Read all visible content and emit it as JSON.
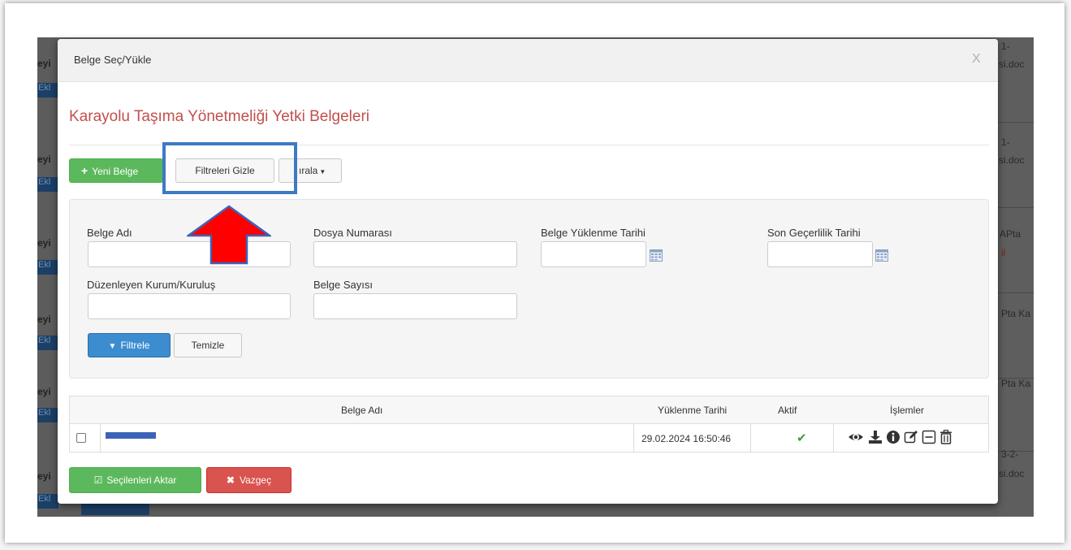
{
  "modal": {
    "title": "Belge Seç/Yükle",
    "close_label": "X",
    "heading": "Karayolu Taşıma Yönetmeliği Yetki Belgeleri"
  },
  "toolbar": {
    "new_document": "Yeni Belge",
    "hide_filters": "Filtreleri Gizle",
    "sort_partial": "ırala"
  },
  "filters": {
    "belge_adi_label": "Belge Adı",
    "dosya_numarasi_label": "Dosya Numarası",
    "yuklenme_tarihi_label": "Belge Yüklenme Tarihi",
    "son_gecerlilik_label": "Son Geçerlilik Tarihi",
    "duzenleyen_label": "Düzenleyen Kurum/Kuruluş",
    "belge_sayisi_label": "Belge Sayısı",
    "filter_button": "Filtrele",
    "clear_button": "Temizle"
  },
  "table": {
    "headers": [
      "Belge Adı",
      "Yüklenme Tarihi",
      "Aktif",
      "İşlemler"
    ],
    "rows": [
      {
        "belge_adi": "",
        "yuklenme_tarihi": "29.02.2024 16:50:46",
        "aktif": "✔"
      }
    ],
    "action_icons": [
      "eye-icon",
      "download-icon",
      "info-icon",
      "edit-icon",
      "minus-square-icon",
      "trash-icon"
    ]
  },
  "footer": {
    "transfer_selected": "Seçilenleri Aktar",
    "cancel": "Vazgeç"
  },
  "background": {
    "left_fragments": [
      "eyi",
      "Ekl",
      "eyi",
      "Ekl",
      "eyi",
      "Ekl",
      "eyi",
      "Ekl",
      "eyi",
      "Ekl",
      "eyi",
      "Ekl"
    ],
    "right_fragments": [
      "1-",
      "si.doc",
      "1-",
      "si.doc",
      "APta",
      "il",
      "Pta Ka",
      "Pta Ka",
      "3-2-",
      "si.doc"
    ]
  },
  "colors": {
    "heading": "#c0504d",
    "green_button": "#5cb85c",
    "primary_button": "#3c8dd0",
    "red_button": "#d9534f",
    "highlight_box": "#3d7ac4",
    "arrow": "#ff0000"
  }
}
